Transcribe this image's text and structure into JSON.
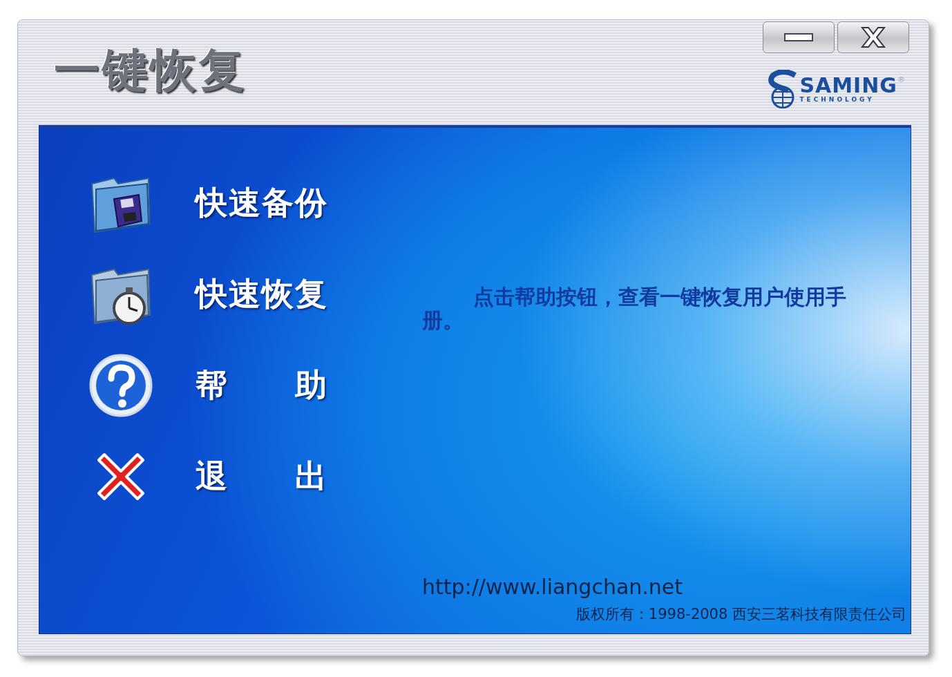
{
  "window": {
    "title": "一键恢复"
  },
  "logo": {
    "name": "SAMING",
    "tagline": "TECHNOLOGY",
    "mark": "®"
  },
  "menu": [
    {
      "kind": "backup",
      "label": "快速备份"
    },
    {
      "kind": "restore",
      "label": "快速恢复"
    },
    {
      "kind": "help",
      "label": "帮 助"
    },
    {
      "kind": "exit",
      "label": "退 出"
    }
  ],
  "message": "点击帮助按钮，查看一键恢复用户使用手册。",
  "footer": {
    "url": "http://www.liangchan.net",
    "copyright": "版权所有：1998-2008 西安三茗科技有限责任公司"
  }
}
